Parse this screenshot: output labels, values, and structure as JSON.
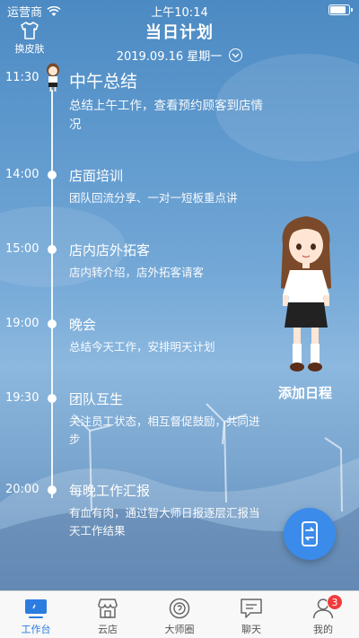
{
  "status_bar": {
    "carrier": "运营商",
    "time": "上午10:14"
  },
  "header": {
    "skin_label": "换皮肤",
    "title": "当日计划",
    "date": "2019.09.16 星期一"
  },
  "events": [
    {
      "time": "11:30",
      "title": "中午总结",
      "desc": "总结上午工作，查看预约顾客到店情况"
    },
    {
      "time": "14:00",
      "title": "店面培训",
      "desc": "团队回流分享、一对一短板重点讲"
    },
    {
      "time": "15:00",
      "title": "店内店外拓客",
      "desc": "店内转介绍，店外拓客请客"
    },
    {
      "time": "19:00",
      "title": "晚会",
      "desc": "总结今天工作，安排明天计划"
    },
    {
      "time": "19:30",
      "title": "团队互生",
      "desc": "关注员工状态，相互督促鼓励，共同进步"
    },
    {
      "time": "20:00",
      "title": "每晚工作汇报",
      "desc": "有血有肉，通过智大师日报逐层汇报当天工作结果"
    }
  ],
  "add_schedule_label": "添加日程",
  "tabbar": {
    "items": [
      {
        "label": "工作台",
        "icon": "workbench-icon"
      },
      {
        "label": "云店",
        "icon": "cloud-store-icon"
      },
      {
        "label": "大师圈",
        "icon": "master-circle-icon"
      },
      {
        "label": "聊天",
        "icon": "chat-icon"
      },
      {
        "label": "我的",
        "icon": "profile-icon",
        "badge": "3"
      }
    ]
  },
  "colors": {
    "accent": "#2b7de0",
    "fab": "#3b8bea",
    "badge": "#f23b3b"
  }
}
